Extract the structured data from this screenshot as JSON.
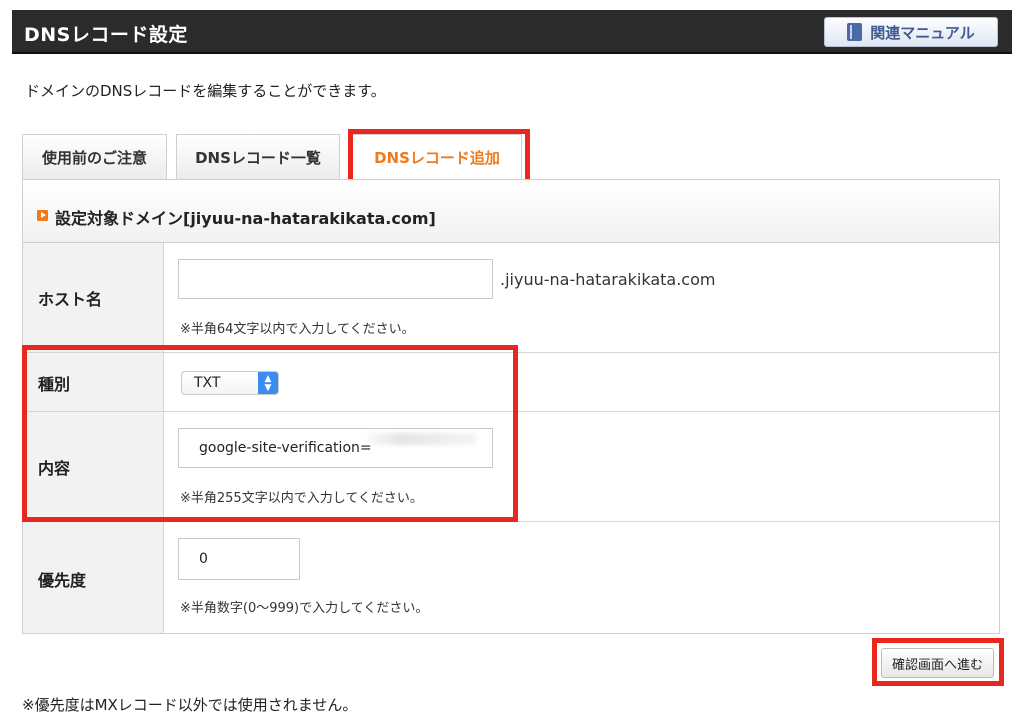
{
  "header": {
    "title": "DNSレコード設定",
    "manual_button": "関連マニュアル"
  },
  "intro": "ドメインのDNSレコードを編集することができます。",
  "tabs": [
    {
      "label": "使用前のご注意",
      "active": false
    },
    {
      "label": "DNSレコード一覧",
      "active": false
    },
    {
      "label": "DNSレコード追加",
      "active": true
    }
  ],
  "form": {
    "domain_heading": "設定対象ドメイン[jiyuu-na-hatarakikata.com]",
    "host": {
      "label": "ホスト名",
      "value": "",
      "suffix": ".jiyuu-na-hatarakikata.com",
      "hint": "※半角64文字以内で入力してください。"
    },
    "type": {
      "label": "種別",
      "selected": "TXT"
    },
    "content": {
      "label": "内容",
      "value": "google-site-verification=",
      "hint": "※半角255文字以内で入力してください。"
    },
    "priority": {
      "label": "優先度",
      "value": "0",
      "hint": "※半角数字(0〜999)で入力してください。"
    }
  },
  "confirm_button": "確認画面へ進む",
  "footnote": "※優先度はMXレコード以外では使用されません。",
  "colors": {
    "header_bg": "#2b2b2b",
    "active_tab_text": "#f07a1a",
    "highlight": "#e8281e",
    "select_accent": "#3d8cf0"
  }
}
